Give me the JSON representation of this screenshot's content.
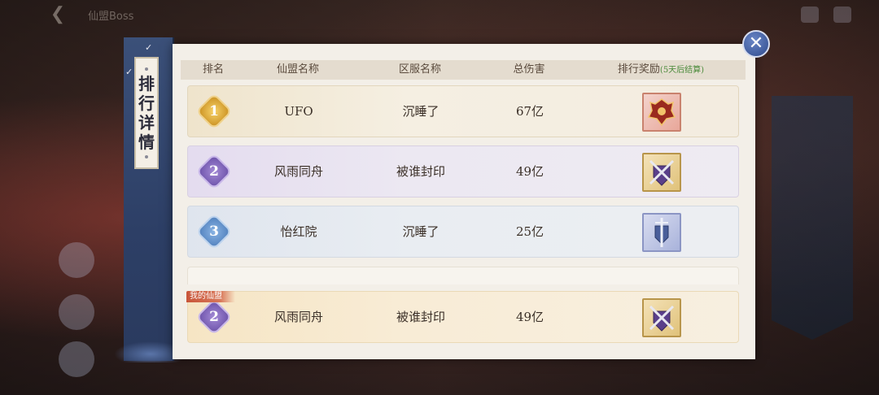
{
  "topbar": {
    "back_icon": "back-arrow-icon",
    "title": "仙盟Boss"
  },
  "side_tab": {
    "chars": [
      "排",
      "行",
      "详",
      "情"
    ]
  },
  "close_icon": "close-icon",
  "header": {
    "rank": "排名",
    "guild_name": "仙盟名称",
    "server_name": "区服名称",
    "total_damage": "总伤害",
    "reward": "排行奖励",
    "reward_note": "(5天后结算)"
  },
  "rows": [
    {
      "rank": "1",
      "guild": "UFO",
      "server": "沉睡了",
      "damage": "67亿",
      "medal": "gold",
      "reward_icon": "red-dragon-crest-icon"
    },
    {
      "rank": "2",
      "guild": "风雨同舟",
      "server": "被谁封印",
      "damage": "49亿",
      "medal": "purple",
      "reward_icon": "purple-crossed-swords-crest-icon"
    },
    {
      "rank": "3",
      "guild": "怡红院",
      "server": "沉睡了",
      "damage": "25亿",
      "medal": "blue",
      "reward_icon": "blue-sword-crest-icon"
    }
  ],
  "my_row": {
    "tag": "我的仙盟",
    "rank": "2",
    "guild": "风雨同舟",
    "server": "被谁封印",
    "damage": "49亿",
    "medal": "purple",
    "reward_icon": "purple-crossed-swords-crest-icon"
  },
  "colors": {
    "panel_bg": "#f3efe8",
    "tab_blue": "#2d3f66",
    "gold": "#c98e1e",
    "purple": "#6a4fa8",
    "blue": "#4f7fbc",
    "tag_red": "#c8553a",
    "note_green": "#4a8a3a"
  }
}
